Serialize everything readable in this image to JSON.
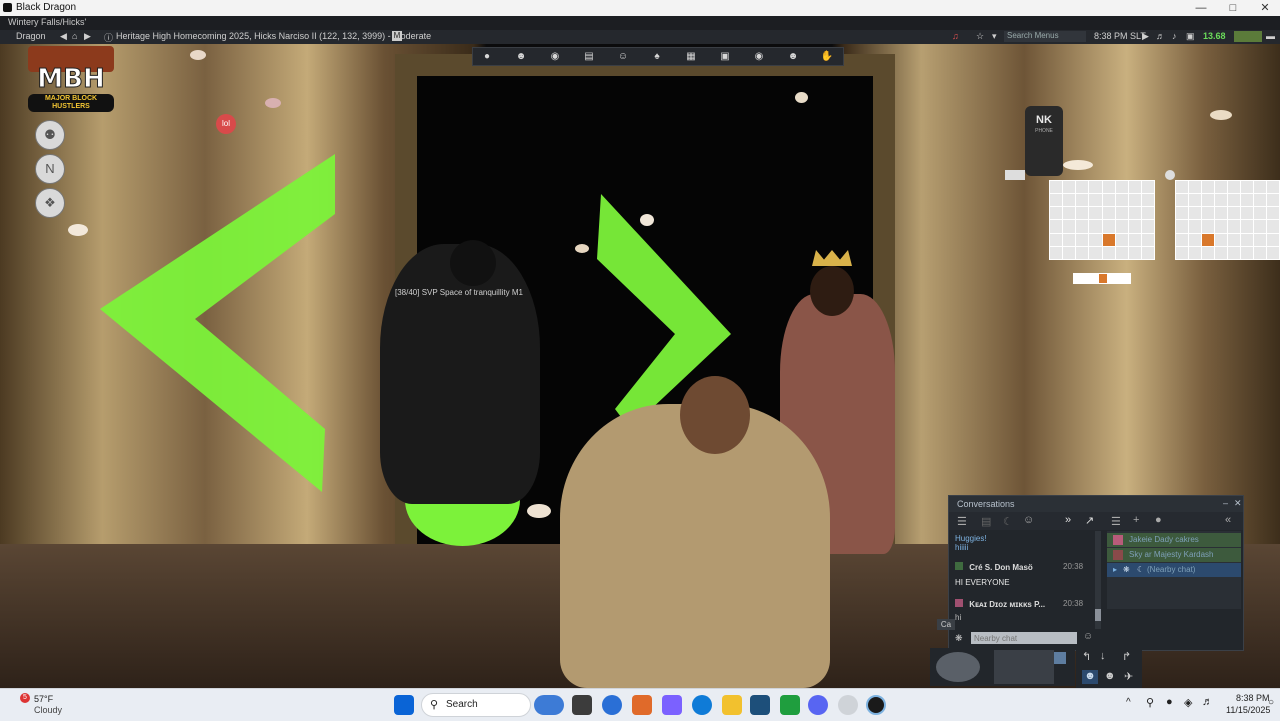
{
  "window": {
    "title": "Black Dragon"
  },
  "viewer": {
    "region_status": "Wintery Falls/Hicks'",
    "menu_label": "Dragon",
    "location": "Heritage High Homecoming 2025, Hicks Narciso II (122, 132, 3999) - Moderate",
    "maturity_badge": "M",
    "search_placeholder": "Search Menus",
    "time": "8:38 PM SLT",
    "fps": "13.68"
  },
  "scene": {
    "hover_text": "[38/40] SVP Space of tranquillity M1",
    "logo_text": {
      "line1": "MBH",
      "line2": "MAJOR BLOCK",
      "line3": "HUSTLERS"
    },
    "hud_brand": "NK",
    "hud_brand_sub": "PHONE",
    "arrow_color": "#7cf23a"
  },
  "conversations": {
    "title": "Conversations",
    "messages": [
      {
        "name": "Huggies!",
        "text": "hiiiii"
      },
      {
        "name": "Cré S. Don Masö",
        "time": "20:38",
        "text": "HI EVERYONE"
      },
      {
        "name": "Kᴇᴀɪ Dɪᴏᴢ ᴍɪᴋᴋs P...",
        "time": "20:38",
        "text": "hi"
      }
    ],
    "participants": [
      {
        "name": "Jakeie Dady cakres"
      },
      {
        "name": "Sky ar Majesty Kardash"
      },
      {
        "name": "(Nearby chat)"
      }
    ],
    "input_placeholder": "Nearby chat",
    "cut_label": "Ca"
  },
  "taskbar": {
    "weather_temp": "57°F",
    "weather_desc": "Cloudy",
    "weather_badge": "5",
    "search_label": "Search",
    "clock_time": "8:38 PM",
    "clock_date": "11/15/2025"
  }
}
